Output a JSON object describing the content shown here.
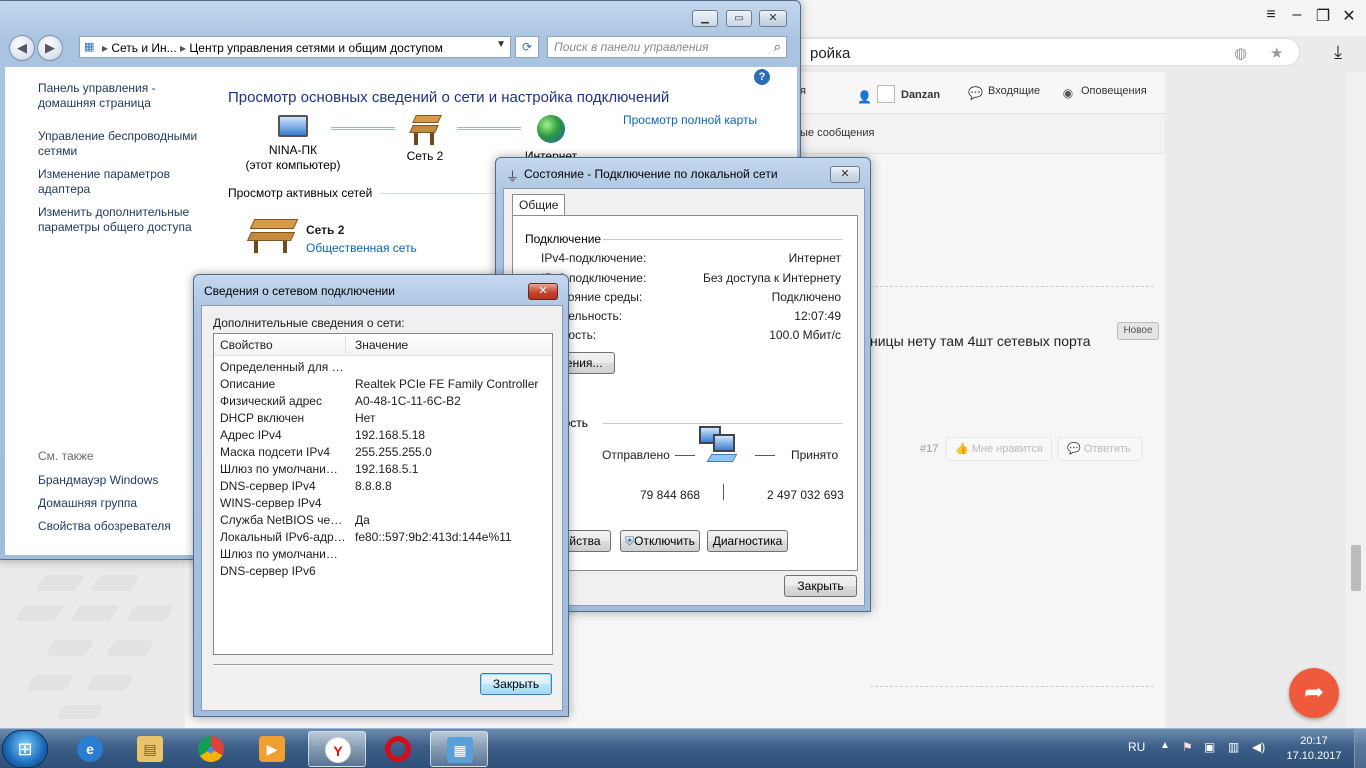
{
  "browser": {
    "address_text": "ройка",
    "user_name": "Danzan",
    "header_partial": "я",
    "inbox_label": "Входящие",
    "notifications_label": "Оповещения",
    "sub_partial": "ые сообщения",
    "post_snippet": "ницы нету там 4шт сетевых порта",
    "new_badge": "Новое",
    "post_number": "#17",
    "like_label": "Мне нравится",
    "reply_label": "Ответить"
  },
  "control_panel": {
    "breadcrumb": [
      "Сеть и Ин...",
      "Центр управления сетями и общим доступом"
    ],
    "search_placeholder": "Поиск в панели управления",
    "left_links": [
      "Панель управления - домашняя страница",
      "Управление беспроводными сетями",
      "Изменение параметров адаптера",
      "Изменить дополнительные параметры общего доступа"
    ],
    "see_also_title": "См. также",
    "see_also_links": [
      "Брандмауэр Windows",
      "Домашняя группа",
      "Свойства обозревателя"
    ],
    "heading": "Просмотр основных сведений о сети и настройка подключений",
    "full_map_link": "Просмотр полной карты",
    "map_nodes": [
      {
        "name": "NINA-ПК",
        "sub": "(этот компьютер)"
      },
      {
        "name": "Сеть  2"
      },
      {
        "name": "Интернет"
      }
    ],
    "active_networks_title": "Просмотр активных сетей",
    "network_name": "Сеть  2",
    "network_type": "Общественная сеть"
  },
  "status_window": {
    "title": "Состояние - Подключение по локальной сети",
    "tab": "Общие",
    "group_connection": "Подключение",
    "rows": [
      {
        "k": "IPv4-подключение:",
        "v": "Интернет"
      },
      {
        "k": "IPv6-подключение:",
        "v": "Без доступа к Интернету"
      },
      {
        "k": "Состояние среды:",
        "v": "Подключено"
      },
      {
        "k": "Длительность:",
        "v": "12:07:49"
      },
      {
        "k": "Скорость:",
        "v": "100.0 Мбит/с"
      }
    ],
    "details_button": "Сведения...",
    "group_activity": "Активность",
    "sent_label": "Отправлено",
    "received_label": "Принято",
    "sent_value": "79 844 868",
    "received_value": "2 497 032 693",
    "properties_button": "Свойства",
    "disable_button": "Отключить",
    "diagnose_button": "Диагностика",
    "close_button": "Закрыть"
  },
  "details_window": {
    "title": "Сведения о сетевом подключении",
    "label": "Дополнительные сведения о сети:",
    "col_property": "Свойство",
    "col_value": "Значение",
    "rows": [
      {
        "k": "Определенный для по...",
        "v": ""
      },
      {
        "k": "Описание",
        "v": "Realtek PCIe FE Family Controller"
      },
      {
        "k": "Физический адрес",
        "v": "A0-48-1C-11-6C-B2"
      },
      {
        "k": "DHCP включен",
        "v": "Нет"
      },
      {
        "k": "Адрес IPv4",
        "v": "192.168.5.18"
      },
      {
        "k": "Маска подсети IPv4",
        "v": "255.255.255.0"
      },
      {
        "k": "Шлюз по умолчанию IP...",
        "v": "192.168.5.1"
      },
      {
        "k": "DNS-сервер IPv4",
        "v": "8.8.8.8"
      },
      {
        "k": "WINS-сервер IPv4",
        "v": ""
      },
      {
        "k": "Служба NetBIOS через...",
        "v": "Да"
      },
      {
        "k": "Локальный IPv6-адрес...",
        "v": "fe80::597:9b2:413d:144e%11"
      },
      {
        "k": "Шлюз по умолчанию IP...",
        "v": ""
      },
      {
        "k": "DNS-сервер IPv6",
        "v": ""
      }
    ],
    "close_button": "Закрыть"
  },
  "taskbar": {
    "language": "RU",
    "time": "20:17",
    "date": "17.10.2017"
  }
}
